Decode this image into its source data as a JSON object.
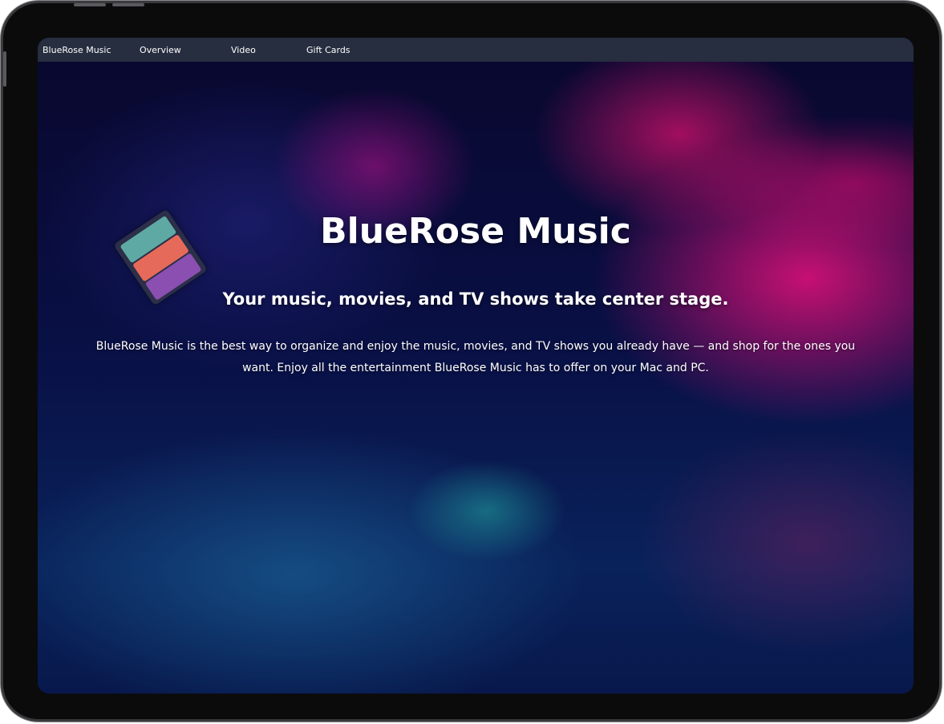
{
  "nav": {
    "brand": "BlueRose Music",
    "items": [
      "Overview",
      "Video",
      "Gift Cards"
    ]
  },
  "hero": {
    "title": "BlueRose Music",
    "subtitle": "Your music, movies, and TV shows take center stage.",
    "description": "BlueRose Music is the best way to organize and enjoy the music, movies, and TV shows you already have — and shop for the ones you want. Enjoy all the entertainment BlueRose Music has to offer on your Mac and PC."
  },
  "colors": {
    "nav_background": "#262e3f",
    "text": "#ffffff",
    "accent_pink": "#ff148c",
    "accent_blue": "#0c2a6a"
  }
}
